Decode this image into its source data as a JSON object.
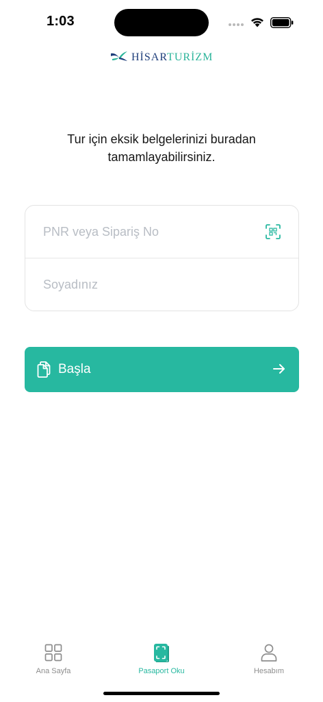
{
  "status_bar": {
    "time": "1:03"
  },
  "logo": {
    "part1": "HİSAR",
    "part2": "TURİZM",
    "colors": {
      "primary": "#1d3d7a",
      "secondary": "#2bb49a"
    }
  },
  "intro_text": "Tur için eksik belgelerinizi buradan tamamlayabilirsiniz.",
  "form": {
    "pnr_placeholder": "PNR veya Sipariş No",
    "surname_placeholder": "Soyadınız",
    "qr_icon": "qr-scan-icon"
  },
  "start_button": {
    "label": "Başla",
    "icon_left": "documents-icon",
    "icon_right": "arrow-right-icon",
    "color": "#27b8a0"
  },
  "tab_bar": {
    "items": [
      {
        "label": "Ana Sayfa",
        "icon": "grid-icon",
        "active": false
      },
      {
        "label": "Pasaport Oku",
        "icon": "passport-scan-icon",
        "active": true
      },
      {
        "label": "Hesabım",
        "icon": "user-icon",
        "active": false
      }
    ],
    "active_color": "#27b8a0",
    "inactive_color": "#8d8d8d"
  }
}
